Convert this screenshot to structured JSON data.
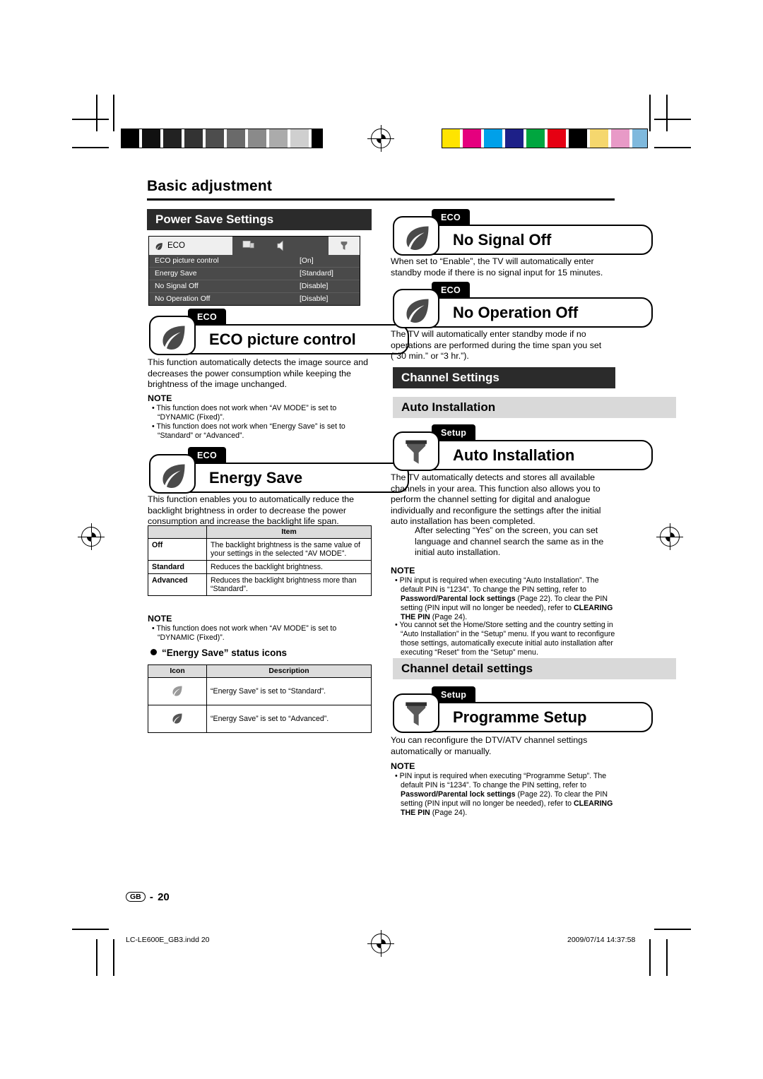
{
  "page": {
    "heading": "Basic adjustment",
    "footer_page": "20",
    "footer_gb": "GB",
    "footer_file": "LC-LE600E_GB3.indd   20",
    "footer_date": "2009/07/14   14:37:58"
  },
  "left": {
    "section_bar": "Power Save Settings",
    "menu": {
      "tab_label": "ECO",
      "rows": [
        {
          "label": "ECO picture control",
          "value": "[On]"
        },
        {
          "label": "Energy Save",
          "value": "[Standard]"
        },
        {
          "label": "No Signal Off",
          "value": "[Disable]"
        },
        {
          "label": "No Operation Off",
          "value": "[Disable]"
        }
      ]
    },
    "eco_picture": {
      "tag": "ECO",
      "title": "ECO picture control",
      "body": "This function automatically detects the image source and decreases the power consumption while keeping the brightness of the image unchanged.",
      "note_label": "NOTE",
      "notes": [
        "This function does not work when “AV MODE” is set to “DYNAMIC (Fixed)”.",
        "This function does not work when “Energy Save” is set to “Standard” or “Advanced”."
      ]
    },
    "energy_save": {
      "tag": "ECO",
      "title": "Energy Save",
      "body": "This function enables you to automatically reduce the backlight brightness in order to decrease the power consumption and increase the backlight life span.",
      "table": {
        "header": "Item",
        "rows": [
          {
            "item": "Off",
            "desc": "The backlight brightness is the same value of your settings in the selected “AV MODE”."
          },
          {
            "item": "Standard",
            "desc": "Reduces the backlight brightness."
          },
          {
            "item": "Advanced",
            "desc": "Reduces the backlight brightness more than “Standard”."
          }
        ]
      },
      "note_label": "NOTE",
      "notes": [
        "This function does not work when “AV MODE” is set to “DYNAMIC (Fixed)”."
      ],
      "status_icons_heading": "“Energy Save” status icons",
      "icons_table": {
        "headers": [
          "Icon",
          "Description"
        ],
        "rows": [
          {
            "icon": "leaf-icon-standard",
            "desc": "“Energy Save” is set to “Standard”."
          },
          {
            "icon": "leaf-icon-advanced",
            "desc": "“Energy Save” is set to “Advanced”."
          }
        ]
      }
    }
  },
  "right": {
    "no_signal_off": {
      "tag": "ECO",
      "title": "No Signal Off",
      "body": "When set to “Enable”, the TV will automatically enter standby mode if there is no signal input for 15 minutes."
    },
    "no_operation_off": {
      "tag": "ECO",
      "title": "No Operation Off",
      "body": "The TV will automatically enter standby mode if no operations are performed during the time span you set (“30 min.” or “3 hr.”)."
    },
    "channel_settings_bar": "Channel Settings",
    "auto_installation_bar": "Auto Installation",
    "auto_installation": {
      "tag": "Setup",
      "title": "Auto Installation",
      "body": "The TV automatically detects and stores all available channels in your area. This function also allows you to perform the channel setting for digital and analogue individually and reconfigure the settings after the initial auto installation has been completed.",
      "body2": "After selecting “Yes” on the screen, you can set language and channel search the same as in the initial auto installation.",
      "note_label": "NOTE",
      "notes": [
        "PIN input is required when executing “Auto Installation”. The default PIN is “1234”. To change the PIN setting, refer to Password/Parental lock settings (Page 22). To clear the PIN setting (PIN input will no longer be needed), refer to CLEARING THE PIN (Page 24).",
        "You cannot set the Home/Store setting and the country setting in “Auto Installation” in the “Setup” menu. If you want to reconfigure those settings, automatically execute initial auto installation after executing “Reset” from the “Setup” menu."
      ]
    },
    "channel_detail_bar": "Channel detail settings",
    "programme_setup": {
      "tag": "Setup",
      "title": "Programme Setup",
      "body": "You can reconfigure the DTV/ATV channel settings automatically or manually.",
      "note_label": "NOTE",
      "notes": [
        "PIN input is required when executing “Programme Setup”. The default PIN is “1234”. To change the PIN setting, refer to Password/Parental lock settings (Page 22). To clear the PIN setting (PIN input will no longer be needed), refer to CLEARING THE PIN (Page 24)."
      ]
    }
  },
  "colors": {
    "bar_dark": "#2b2b2b",
    "bar_grey": "#d9d9d9",
    "menu_bg": "#4a4a4a",
    "leaf_green": "#4a4a4a"
  }
}
